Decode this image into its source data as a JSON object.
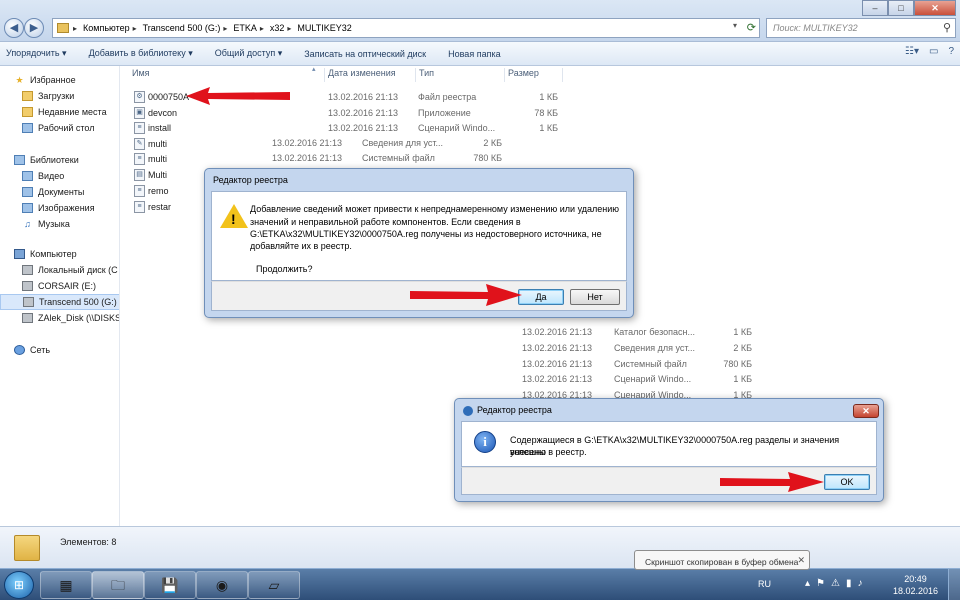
{
  "explorer": {
    "address": [
      "Компьютер",
      "Transcend 500 (G:)",
      "ETKA",
      "x32",
      "MULTIKEY32"
    ],
    "search_placeholder": "Поиск: MULTIKEY32",
    "toolbar": [
      "Упорядочить ▾",
      "Добавить в библиотеку ▾",
      "Общий доступ ▾",
      "Записать на оптический диск",
      "Новая папка"
    ],
    "columns": {
      "name": "Имя",
      "date": "Дата изменения",
      "type": "Тип",
      "size": "Размер"
    },
    "sidebar": {
      "favorites": "Избранное",
      "downloads": "Загрузки",
      "recent": "Недавние места",
      "desktop": "Рабочий стол",
      "libraries": "Библиотеки",
      "video": "Видео",
      "documents": "Документы",
      "images": "Изображения",
      "music": "Музыка",
      "computer": "Компьютер",
      "local_disk": "Локальный диск (C",
      "corsair": "CORSAIR (E:)",
      "transcend": "Transcend 500 (G:)",
      "zalek": "ZAlek_Disk (\\\\DISKS",
      "network": "Сеть"
    },
    "files": [
      {
        "name": "0000750A",
        "date": "13.02.2016 21:13",
        "type": "Файл реестра",
        "size": "1 КБ"
      },
      {
        "name": "devcon",
        "date": "13.02.2016 21:13",
        "type": "Приложение",
        "size": "78 КБ"
      },
      {
        "name": "install",
        "date": "13.02.2016 21:13",
        "type": "Сценарий Windo...",
        "size": "1 КБ"
      },
      {
        "name": "multi"
      },
      {
        "name": "multi"
      },
      {
        "name": "Multi"
      },
      {
        "name": "remo"
      },
      {
        "name": "restar"
      }
    ],
    "ghost_rows_upper": [
      {
        "date": "13.02.2016 21:13",
        "type": "Сведения для уст...",
        "size": "2 КБ"
      },
      {
        "date": "13.02.2016 21:13",
        "type": "Системный файл",
        "size": "780 КБ"
      }
    ],
    "ghost_rows_lower": [
      {
        "date": "13.02.2016 21:13",
        "type": "Каталог безопасн...",
        "size": "1 КБ"
      },
      {
        "date": "13.02.2016 21:13",
        "type": "Сведения для уст...",
        "size": "2 КБ"
      },
      {
        "date": "13.02.2016 21:13",
        "type": "Системный файл",
        "size": "780 КБ"
      },
      {
        "date": "13.02.2016 21:13",
        "type": "Сценарий Windo...",
        "size": "1 КБ"
      },
      {
        "date": "13.02.2016 21:13",
        "type": "Сценарий Windo...",
        "size": "1 КБ"
      }
    ],
    "status": "Элементов: 8"
  },
  "dialog1": {
    "title": "Редактор реестра",
    "line1": "Добавление сведений может привести к непреднамеренному изменению или удалению",
    "line2": "значений и неправильной работе компонентов. Если сведения в",
    "line3": "G:\\ETKA\\x32\\MULTIKEY32\\0000750A.reg получены из недостоверного источника, не",
    "line4": "добавляйте их в реестр.",
    "question": "Продолжить?",
    "yes": "Да",
    "no": "Нет"
  },
  "dialog2": {
    "title": "Редактор реестра",
    "line1": "Содержащиеся в G:\\ETKA\\x32\\MULTIKEY32\\0000750A.reg разделы и значения успешно",
    "line2": "внесены в реестр.",
    "ok": "OK"
  },
  "toast": "Скриншот скопирован в буфер обмена",
  "taskbar": {
    "lang": "RU",
    "time": "20:49",
    "date": "18.02.2016"
  },
  "colors": {
    "arrow": "#e0121b",
    "accent": "#2e6db8"
  }
}
